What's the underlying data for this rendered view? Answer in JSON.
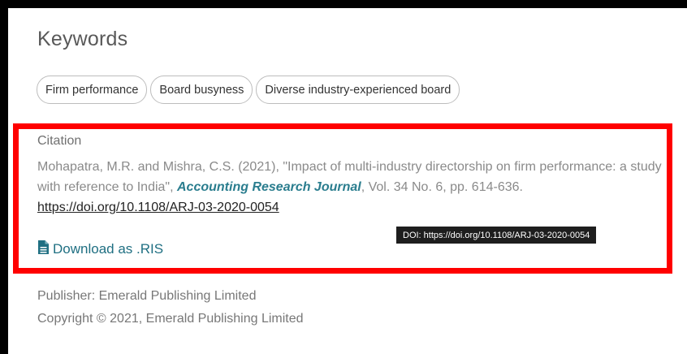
{
  "keywords": {
    "title": "Keywords",
    "items": [
      {
        "label": "Firm performance"
      },
      {
        "label": "Board busyness"
      },
      {
        "label": "Diverse industry-experienced board"
      }
    ]
  },
  "citation": {
    "label": "Citation",
    "text_before_journal": "Mohapatra, M.R. and Mishra, C.S. (2021), \"Impact of multi-industry directorship on firm performance: a study with reference to India\", ",
    "journal": "Accounting Research Journal",
    "text_after_journal": ", Vol. 34 No. 6, pp. 614-636. ",
    "doi_link": "https://doi.org/10.1108/ARJ-03-2020-0054",
    "tooltip": "DOI: https://doi.org/10.1108/ARJ-03-2020-0054",
    "download_label": "Download as .RIS",
    "download_icon": "document-icon"
  },
  "publisher": {
    "publisher_line": "Publisher: Emerald Publishing Limited",
    "copyright_line": "Copyright © 2021, Emerald Publishing Limited"
  },
  "colors": {
    "highlight_border": "#ff0000",
    "journal": "#2a7d8e",
    "download": "#1f6f82",
    "tooltip_bg": "#1e1e1e"
  }
}
